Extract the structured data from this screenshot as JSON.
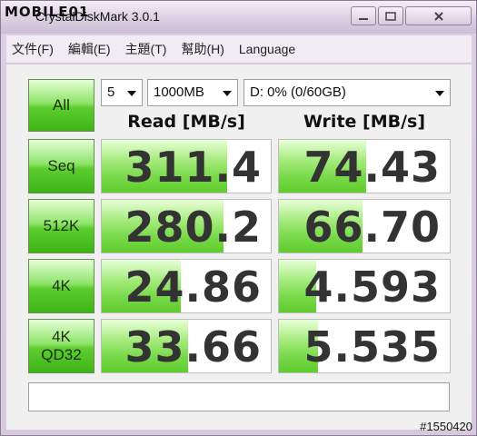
{
  "watermark": "MOBILE01",
  "window": {
    "title": "CrystalDiskMark 3.0.1"
  },
  "menu": [
    "文件(F)",
    "編輯(E)",
    "主題(T)",
    "幫助(H)",
    "Language"
  ],
  "controls": {
    "all_label": "All"
  },
  "settings": {
    "runs": "5",
    "size": "1000MB",
    "drive": "D: 0% (0/60GB)"
  },
  "columns": {
    "read": "Read [MB/s]",
    "write": "Write [MB/s]"
  },
  "tests": [
    {
      "label": "Seq",
      "read": "311.4",
      "write": "74.43",
      "read_level": 0.74,
      "write_level": 0.51
    },
    {
      "label": "512K",
      "read": "280.2",
      "write": "66.70",
      "read_level": 0.72,
      "write_level": 0.49
    },
    {
      "label": "4K",
      "read": "24.86",
      "write": "4.593",
      "read_level": 0.47,
      "write_level": 0.22
    },
    {
      "label": "4K\nQD32",
      "read": "33.66",
      "write": "5.535",
      "read_level": 0.51,
      "write_level": 0.23
    }
  ],
  "comment": "",
  "footer_tag": "#1550420",
  "icons": {
    "minimize": "minimize-icon",
    "maximize": "maximize-icon",
    "close": "close-icon"
  }
}
